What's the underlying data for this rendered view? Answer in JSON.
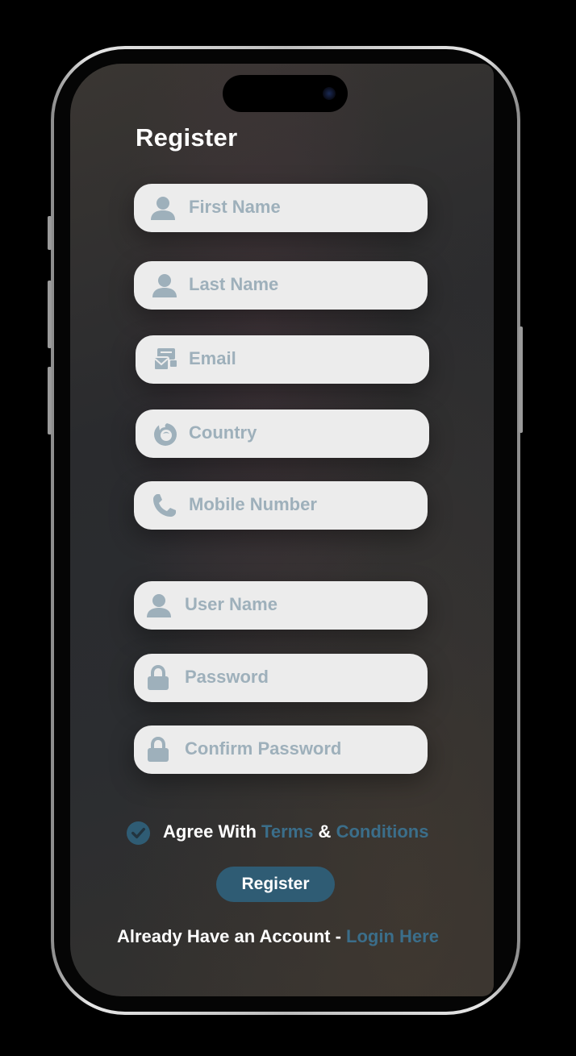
{
  "screen": {
    "title": "Register"
  },
  "form": {
    "first_name": {
      "placeholder": "First Name",
      "icon": "user-icon"
    },
    "last_name": {
      "placeholder": "Last Name",
      "icon": "user-icon"
    },
    "email": {
      "placeholder": "Email",
      "icon": "mail-icon"
    },
    "country": {
      "placeholder": "Country",
      "icon": "globe-icon"
    },
    "mobile": {
      "placeholder": "Mobile Number",
      "icon": "phone-icon"
    },
    "username": {
      "placeholder": "User Name",
      "icon": "user-icon"
    },
    "password": {
      "placeholder": "Password",
      "icon": "lock-icon"
    },
    "confirm_password": {
      "placeholder": "Confirm Password",
      "icon": "lock-icon"
    }
  },
  "agreement": {
    "prefix": "Agree With ",
    "terms": "Terms",
    "amp": " & ",
    "conditions": "Conditions",
    "checked": true
  },
  "register_button": "Register",
  "login": {
    "prefix": "Already Have an Account - ",
    "link": "Login Here"
  },
  "colors": {
    "accent": "#2f5c74",
    "link": "#3b6e8a",
    "field_bg": "#ececec",
    "placeholder": "#9eb0bb",
    "icon": "#9eb0bb"
  }
}
